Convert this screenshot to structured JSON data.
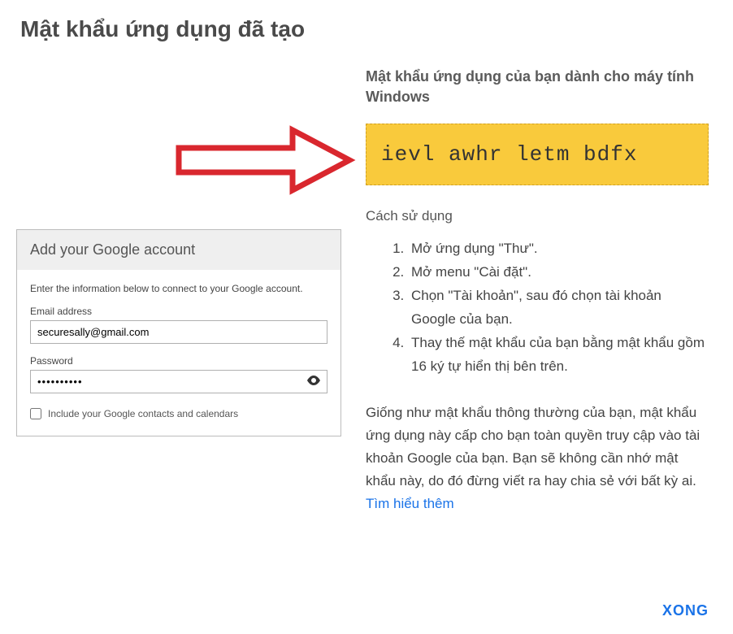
{
  "title": "Mật khẩu ứng dụng đã tạo",
  "right": {
    "subtitle": "Mật khẩu ứng dụng của bạn dành cho máy tính Windows",
    "app_password": "ievl awhr letm bdfx",
    "howto_title": "Cách sử dụng",
    "steps": {
      "s1": "Mở ứng dụng \"Thư\".",
      "s2": "Mở menu \"Cài đặt\".",
      "s3": "Chọn \"Tài khoản\", sau đó chọn tài khoản Google của bạn.",
      "s4": "Thay thế mật khẩu của bạn bằng mật khẩu gồm 16 ký tự hiển thị bên trên."
    },
    "note_text": "Giống như mật khẩu thông thường của bạn, mật khẩu ứng dụng này cấp cho bạn toàn quyền truy cập vào tài khoản Google của bạn. Bạn sẽ không cần nhớ mật khẩu này, do đó đừng viết ra hay chia sẻ với bất kỳ ai. ",
    "learn_more": "Tìm hiểu thêm"
  },
  "form": {
    "header": "Add your Google account",
    "intro": "Enter the information below to connect to your Google account.",
    "email_label": "Email address",
    "email_value": "securesally@gmail.com",
    "password_label": "Password",
    "password_value": "••••••••••",
    "checkbox_label": "Include your Google contacts and calendars"
  },
  "done_label": "XONG"
}
